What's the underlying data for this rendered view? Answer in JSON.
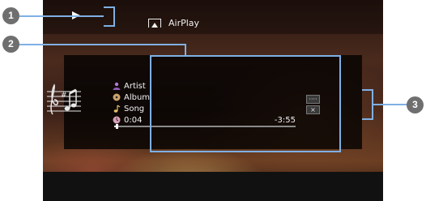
{
  "header": {
    "service_label": "AirPlay"
  },
  "track": {
    "artist": "Artist",
    "album": "Album",
    "song": "Song",
    "elapsed": "0:04",
    "remaining": "-3:55",
    "progress_fraction": 0.015
  },
  "icons": {
    "playback": "play-icon",
    "service": "airplay-icon",
    "artwork": "music-notes-icon",
    "artist": "person-icon",
    "album": "disc-icon",
    "song": "note-icon",
    "time": "clock-icon"
  },
  "side_menu": {
    "option_label": "····",
    "close_label": "×"
  },
  "callouts": [
    "1",
    "2",
    "3"
  ],
  "colors": {
    "callout": "#7fb0e4",
    "badge": "#6f6f6f"
  }
}
